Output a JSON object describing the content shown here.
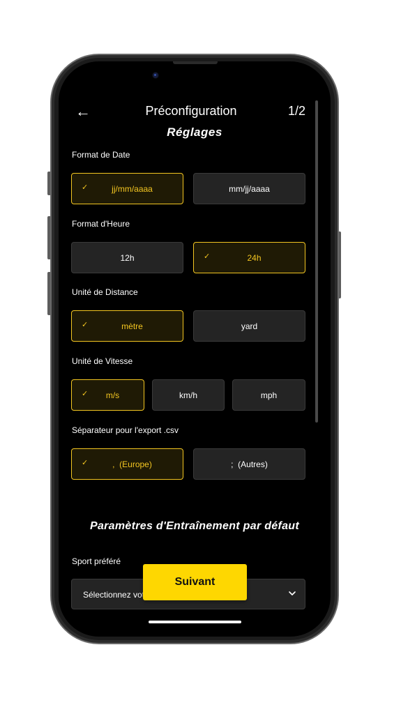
{
  "header": {
    "back_icon": "←",
    "title": "Préconfiguration",
    "step": "1/2"
  },
  "settings": {
    "title": "Réglages",
    "date_format": {
      "label": "Format de Date",
      "options": [
        {
          "label": "jj/mm/aaaa",
          "selected": true
        },
        {
          "label": "mm/jj/aaaa",
          "selected": false
        }
      ]
    },
    "time_format": {
      "label": "Format d'Heure",
      "options": [
        {
          "label": "12h",
          "selected": false
        },
        {
          "label": "24h",
          "selected": true
        }
      ]
    },
    "distance_unit": {
      "label": "Unité de Distance",
      "options": [
        {
          "label": "mètre",
          "selected": true
        },
        {
          "label": "yard",
          "selected": false
        }
      ]
    },
    "speed_unit": {
      "label": "Unité de Vitesse",
      "options": [
        {
          "label": "m/s",
          "selected": true
        },
        {
          "label": "km/h",
          "selected": false
        },
        {
          "label": "mph",
          "selected": false
        }
      ]
    },
    "csv_separator": {
      "label": "Séparateur pour l'export .csv",
      "options": [
        {
          "label": ",  (Europe)",
          "selected": true
        },
        {
          "label": ";  (Autres)",
          "selected": false
        }
      ]
    }
  },
  "training": {
    "title": "Paramètres d'Entraînement par défaut",
    "sport": {
      "label": "Sport préféré",
      "placeholder": "Sélectionnez votre sport"
    }
  },
  "check_icon": "✓",
  "next_button": "Suivant",
  "colors": {
    "accent": "#fed701",
    "selected_border": "#f4c621",
    "option_bg": "#242424"
  }
}
